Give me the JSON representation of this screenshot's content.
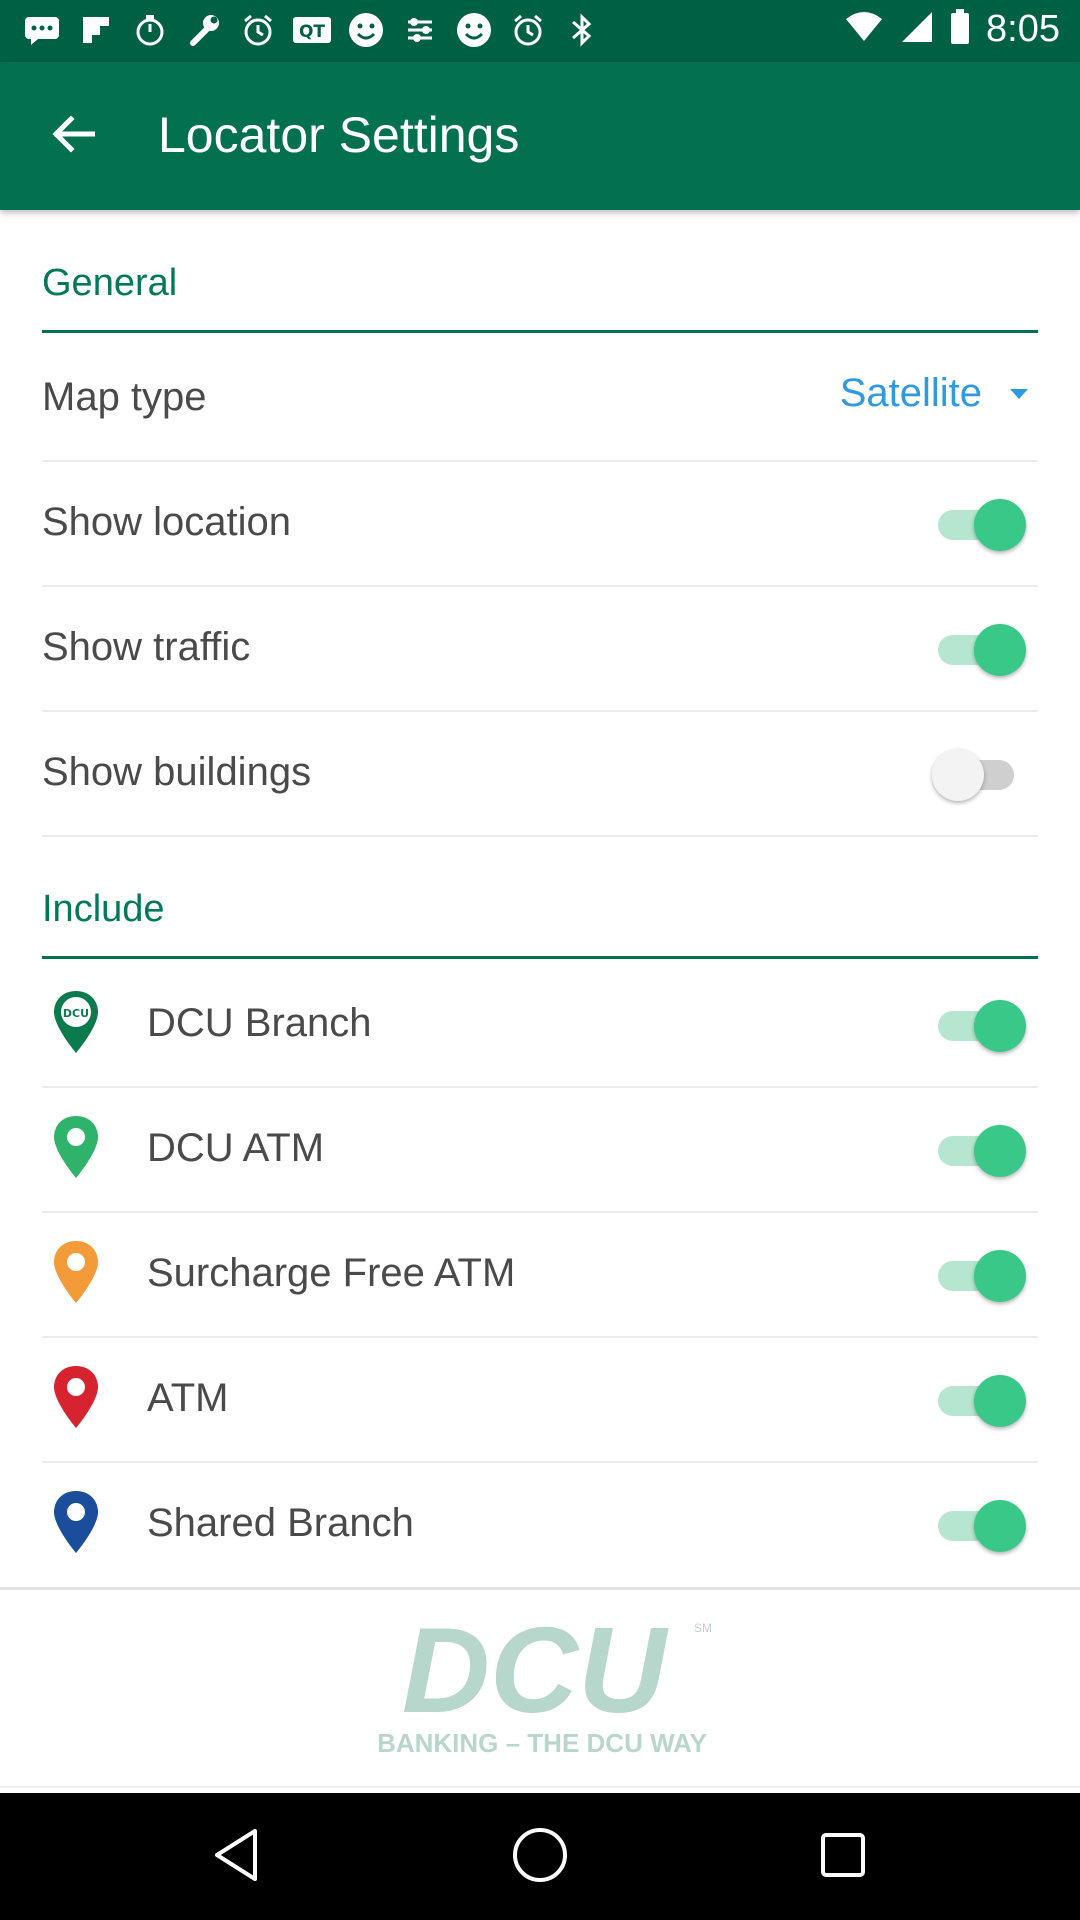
{
  "status_bar": {
    "time": "8:05",
    "icons": [
      "messages-icon",
      "flipboard-icon",
      "timer-icon",
      "wrench-icon",
      "alarm-icon",
      "qt-icon",
      "smiley-icon",
      "settings-app-icon",
      "smiley-icon",
      "alarm-icon",
      "bluetooth-icon",
      "wifi-icon",
      "signal-icon",
      "battery-icon"
    ]
  },
  "app_bar": {
    "title": "Locator Settings",
    "back_icon": "back-arrow-icon"
  },
  "general": {
    "header": "General",
    "map_type": {
      "label": "Map type",
      "value": "Satellite"
    },
    "toggles": [
      {
        "label": "Show location",
        "on": true
      },
      {
        "label": "Show traffic",
        "on": true
      },
      {
        "label": "Show buildings",
        "on": false
      }
    ]
  },
  "include": {
    "header": "Include",
    "items": [
      {
        "label": "DCU Branch",
        "on": true,
        "pin_color": "#0b7a4d",
        "icon": "dcu-branch-pin-icon"
      },
      {
        "label": "DCU ATM",
        "on": true,
        "pin_color": "#2fb36b",
        "icon": "dcu-atm-pin-icon"
      },
      {
        "label": "Surcharge Free ATM",
        "on": true,
        "pin_color": "#f29b38",
        "icon": "surcharge-free-atm-pin-icon"
      },
      {
        "label": "ATM",
        "on": true,
        "pin_color": "#d7232f",
        "icon": "atm-pin-icon"
      },
      {
        "label": "Shared Branch",
        "on": true,
        "pin_color": "#1a4d9a",
        "icon": "shared-branch-pin-icon"
      }
    ]
  },
  "footer": {
    "logo_text": "DCU",
    "tagline": "BANKING – THE DCU WAY",
    "mark": "SM"
  },
  "colors": {
    "status_bar": "#006044",
    "app_bar": "#03704f",
    "accent": "#00795a",
    "toggle_on": "#3ac889",
    "select_text": "#2f9ae0"
  },
  "nav": {
    "icons": [
      "back-triangle-icon",
      "home-circle-icon",
      "recents-square-icon"
    ]
  }
}
